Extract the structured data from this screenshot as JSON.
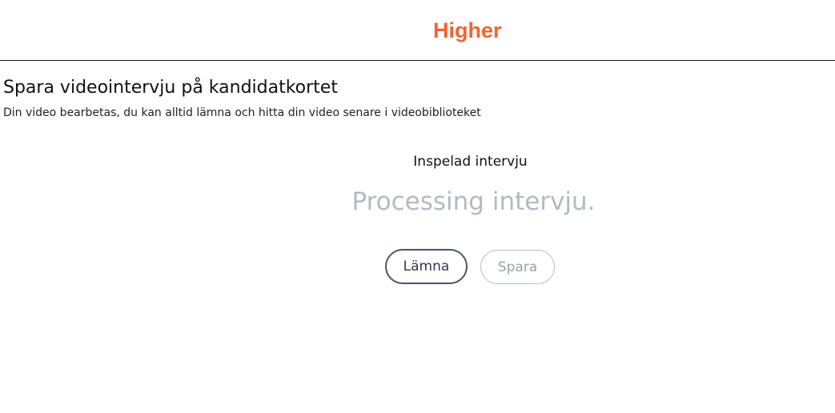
{
  "header": {
    "logo_text": "Higher"
  },
  "main": {
    "title": "Spara videointervju på kandidatkortet",
    "subtitle": "Din video bearbetas, du kan alltid lämna och hitta din video senare i videobiblioteket",
    "recorded_label": "Inspelad intervju",
    "processing_text": "Processing intervju."
  },
  "actions": {
    "leave_label": "Lämna",
    "save_label": "Spara",
    "save_disabled": true
  },
  "colors": {
    "brand": "#f26336",
    "processing_text": "#b4bac3",
    "leave_border": "#4a5567",
    "save_disabled_text": "#9aa1ab"
  }
}
